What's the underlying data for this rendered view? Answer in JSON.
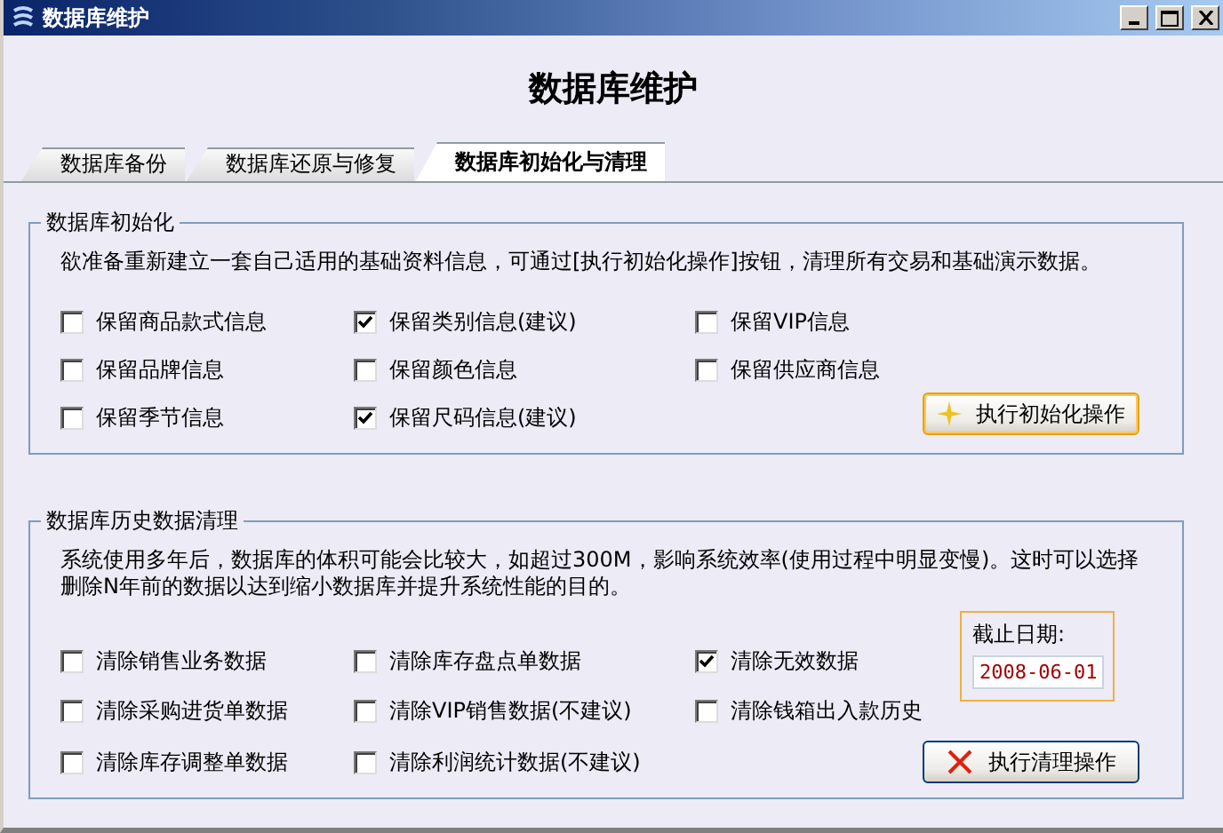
{
  "window": {
    "title": "数据库维护"
  },
  "heading": "数据库维护",
  "tabs": [
    {
      "label": "数据库备份",
      "selected": false
    },
    {
      "label": "数据库还原与修复",
      "selected": false
    },
    {
      "label": "数据库初始化与清理",
      "selected": true
    }
  ],
  "init_group": {
    "title": "数据库初始化",
    "description": "欲准备重新建立一套自己适用的基础资料信息，可通过[执行初始化操作]按钮，清理所有交易和基础演示数据。",
    "options": [
      {
        "label": "保留商品款式信息",
        "checked": false
      },
      {
        "label": "保留类别信息(建议)",
        "checked": true
      },
      {
        "label": "保留VIP信息",
        "checked": false
      },
      {
        "label": "保留品牌信息",
        "checked": false
      },
      {
        "label": "保留颜色信息",
        "checked": false
      },
      {
        "label": "保留供应商信息",
        "checked": false
      },
      {
        "label": "保留季节信息",
        "checked": false
      },
      {
        "label": "保留尺码信息(建议)",
        "checked": true
      }
    ],
    "button": "执行初始化操作"
  },
  "history_group": {
    "title": "数据库历史数据清理",
    "description": "系统使用多年后，数据库的体积可能会比较大，如超过300M，影响系统效率(使用过程中明显变慢)。这时可以选择删除N年前的数据以达到缩小数据库并提升系统性能的目的。",
    "options": [
      {
        "label": "清除销售业务数据",
        "checked": false
      },
      {
        "label": "清除库存盘点单数据",
        "checked": false
      },
      {
        "label": "清除无效数据",
        "checked": true
      },
      {
        "label": "清除采购进货单数据",
        "checked": false
      },
      {
        "label": "清除VIP销售数据(不建议)",
        "checked": false
      },
      {
        "label": "清除钱箱出入款历史",
        "checked": false
      },
      {
        "label": "清除库存调整单数据",
        "checked": false
      },
      {
        "label": "清除利润统计数据(不建议)",
        "checked": false
      }
    ],
    "cutoff": {
      "label": "截止日期:",
      "value": "2008-06-01"
    },
    "button": "执行清理操作"
  }
}
